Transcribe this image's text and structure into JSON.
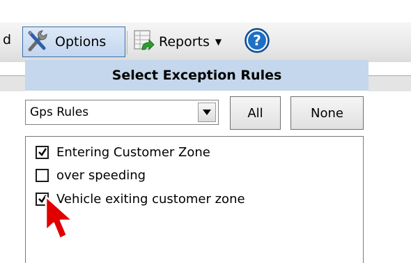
{
  "toolbar": {
    "partial_label": "d",
    "options_label": "Options",
    "reports_label": "Reports",
    "icons": [
      "options-tools-icon",
      "reports-sheet-icon",
      "dropdown-caret-icon",
      "help-question-icon"
    ]
  },
  "panel": {
    "title": "Select Exception Rules",
    "rule_group": {
      "selected": "Gps Rules"
    },
    "all_label": "All",
    "none_label": "None",
    "rules": [
      {
        "label": "Entering Customer Zone",
        "checked": true
      },
      {
        "label": "over speeding",
        "checked": false
      },
      {
        "label": "Vehicle exiting customer zone",
        "checked": true
      }
    ]
  },
  "colors": {
    "header_bg": "#c4d7ec",
    "options_border": "#3a6ea5",
    "help_blue": "#1f6fc5",
    "cursor_red": "#e00000"
  }
}
